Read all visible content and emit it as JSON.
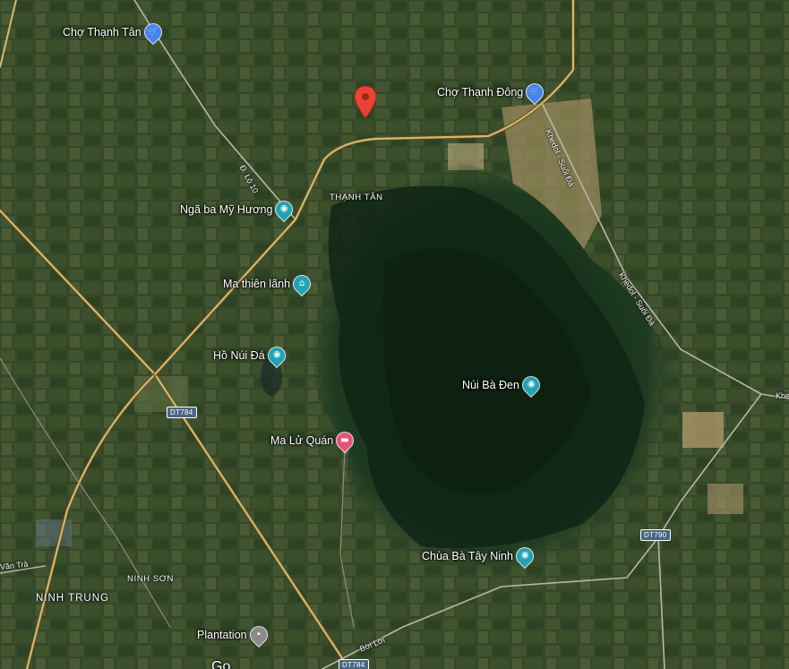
{
  "colors": {
    "road_major": "#d6b86a",
    "road_minor": "#b9b6a8",
    "pin_shopping": "#4285f4",
    "pin_attraction": "#1fa3b5",
    "pin_lodging": "#e7527c",
    "pin_generic": "#8a8a8a",
    "pin_selected": "#ea4335",
    "shield": "#4a6680"
  },
  "pois": [
    {
      "label": "Chợ Thạnh Tân",
      "icon": "shopping-cart-icon"
    },
    {
      "label": "Chợ Thạnh Đông",
      "icon": "shopping-cart-icon"
    },
    {
      "label": "Ngã ba Mỹ Hương",
      "icon": "camera-icon"
    },
    {
      "label": "Ma thiên lãnh",
      "icon": "museum-icon"
    },
    {
      "label": "Hồ Núi Đá",
      "icon": "camera-icon"
    },
    {
      "label": "Núi Bà Đen",
      "icon": "camera-icon"
    },
    {
      "label": "Ma Lử Quán",
      "icon": "bed-icon"
    },
    {
      "label": "Chùa Bà Tây Ninh",
      "icon": "camera-icon"
    },
    {
      "label": "Plantation",
      "icon": "pin-icon"
    }
  ],
  "areas": {
    "thanh_tan": "THẠNH TÂN",
    "ninh_son": "NINH SƠN",
    "ninh_trung": "NINH TRUNG"
  },
  "roads": {
    "dlo10": "Đ. Lộ 10",
    "khedol_top": "Khedol - Suối Đá",
    "khedol_mid": "Khedol - Suối Đá",
    "khe_right": "Khe",
    "boi_loi": "Bời Lời",
    "van_tra": "Văn Trà"
  },
  "shields": {
    "dt784_a": "DT784",
    "dt784_b": "DT784",
    "dt790": "DT790"
  },
  "partial_label": "Go"
}
